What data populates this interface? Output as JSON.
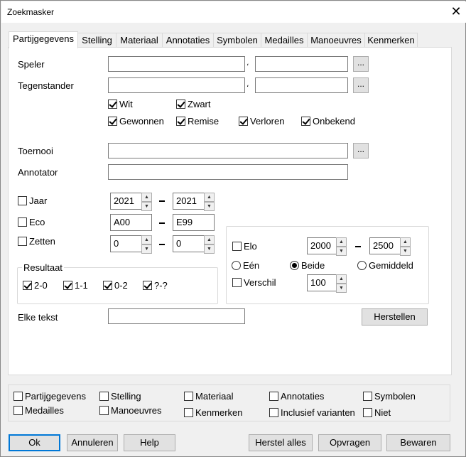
{
  "window": {
    "title": "Zoekmasker",
    "close_icon": "close-icon"
  },
  "tabs": [
    {
      "label": "Partijgegevens",
      "active": true
    },
    {
      "label": "Stelling"
    },
    {
      "label": "Materiaal"
    },
    {
      "label": "Annotaties"
    },
    {
      "label": "Symbolen"
    },
    {
      "label": "Medailles"
    },
    {
      "label": "Manoeuvres"
    },
    {
      "label": "Kenmerken"
    }
  ],
  "form": {
    "speler_label": "Speler",
    "tegenstander_label": "Tegenstander",
    "browse_label": "...",
    "wit": {
      "label": "Wit",
      "checked": true
    },
    "zwart": {
      "label": "Zwart",
      "checked": true
    },
    "gewonnen": {
      "label": "Gewonnen",
      "checked": true
    },
    "remise": {
      "label": "Remise",
      "checked": true
    },
    "verloren": {
      "label": "Verloren",
      "checked": true
    },
    "onbekend": {
      "label": "Onbekend",
      "checked": true
    },
    "toernooi_label": "Toernooi",
    "annotator_label": "Annotator",
    "jaar": {
      "label": "Jaar",
      "checked": false,
      "from": "2021",
      "to": "2021"
    },
    "eco": {
      "label": "Eco",
      "checked": false,
      "from": "A00",
      "to": "E99"
    },
    "zetten": {
      "label": "Zetten",
      "checked": false,
      "from": "0",
      "to": "0"
    },
    "range_dash": "-",
    "resultaat": {
      "title": "Resultaat",
      "items": [
        {
          "label": "2-0",
          "checked": true
        },
        {
          "label": "1-1",
          "checked": true
        },
        {
          "label": "0-2",
          "checked": true
        },
        {
          "label": "?-?",
          "checked": true
        }
      ]
    },
    "elo": {
      "label": "Elo",
      "checked": false,
      "from": "2000",
      "to": "2500"
    },
    "elo_mode": {
      "options": [
        "Eén",
        "Beide",
        "Gemiddeld"
      ],
      "selected": "Beide"
    },
    "verschil": {
      "label": "Verschil",
      "checked": false,
      "value": "100"
    },
    "elke_tekst_label": "Elke tekst",
    "herstellen_label": "Herstellen"
  },
  "bottom_checks": [
    {
      "label": "Partijgegevens",
      "checked": false
    },
    {
      "label": "Stelling",
      "checked": false
    },
    {
      "label": "Materiaal",
      "checked": false
    },
    {
      "label": "Annotaties",
      "checked": false
    },
    {
      "label": "Symbolen",
      "checked": false
    },
    {
      "label": "Medailles",
      "checked": false
    },
    {
      "label": "Manoeuvres",
      "checked": false
    },
    {
      "label": "Kenmerken",
      "checked": false
    },
    {
      "label": "Inclusief varianten",
      "checked": false
    },
    {
      "label": "Niet",
      "checked": false
    }
  ],
  "buttons": {
    "ok": "Ok",
    "annuleren": "Annuleren",
    "help": "Help",
    "herstel_alles": "Herstel alles",
    "opvragen": "Opvragen",
    "bewaren": "Bewaren"
  }
}
